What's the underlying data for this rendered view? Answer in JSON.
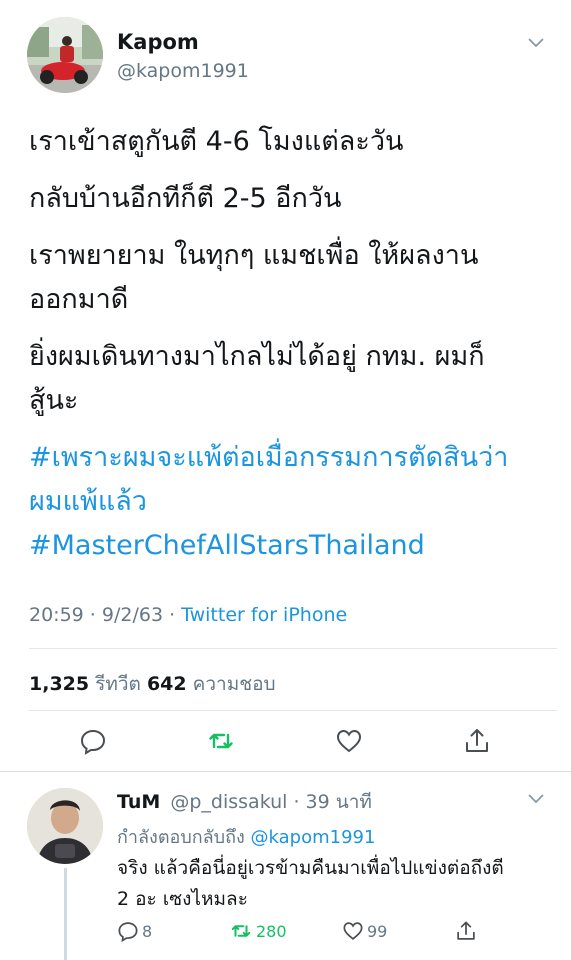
{
  "main_tweet": {
    "name": "Kapom",
    "handle": "@kapom1991",
    "lines": [
      "เราเข้าสตูกันตี 4-6 โมงแต่ละวัน",
      "กลับบ้านอีกทีก็ตี 2-5 อีกวัน",
      "เราพยายาม ในทุกๆ แมชเพื่อ ให้ผลงาน\nออกมาดี",
      "ยิ่งผมเดินทางมาไกลไม่ได้อยู่ กทม. ผมก็\nสู้นะ"
    ],
    "hashtags": [
      "#เพราะผมจะแพ้ต่อเมื่อกรรมการตัดสินว่า\nผมแพ้แล้ว",
      "#MasterChefAllStarsThailand"
    ],
    "time": "20:59 · 9/2/63 · ",
    "source": "Twitter for iPhone",
    "retweet_count": "1,325",
    "retweet_label": " รีทวีต ",
    "like_count": "642",
    "like_label": " ความชอบ"
  },
  "reply": {
    "name": "TuM",
    "handle_time": "@p_dissakul · 39 นาที",
    "replying_prefix": "กำลังตอบกลับถึง ",
    "replying_handle": "@kapom1991",
    "text": "จริง แล้วคือนี่อยู่เวรข้ามคืนมาเพื่อไปแข่งต่อถึงตี\n2 อะ เซงไหมละ",
    "reply_count": "8",
    "retweet_count": "280",
    "like_count": "99"
  },
  "colors": {
    "link": "#1b95e0",
    "secondary": "#657786",
    "retweet_green": "#17bf63",
    "text": "#14171a"
  },
  "icons": [
    "chevron-down-icon",
    "reply-icon",
    "retweet-icon",
    "like-icon",
    "share-icon"
  ]
}
